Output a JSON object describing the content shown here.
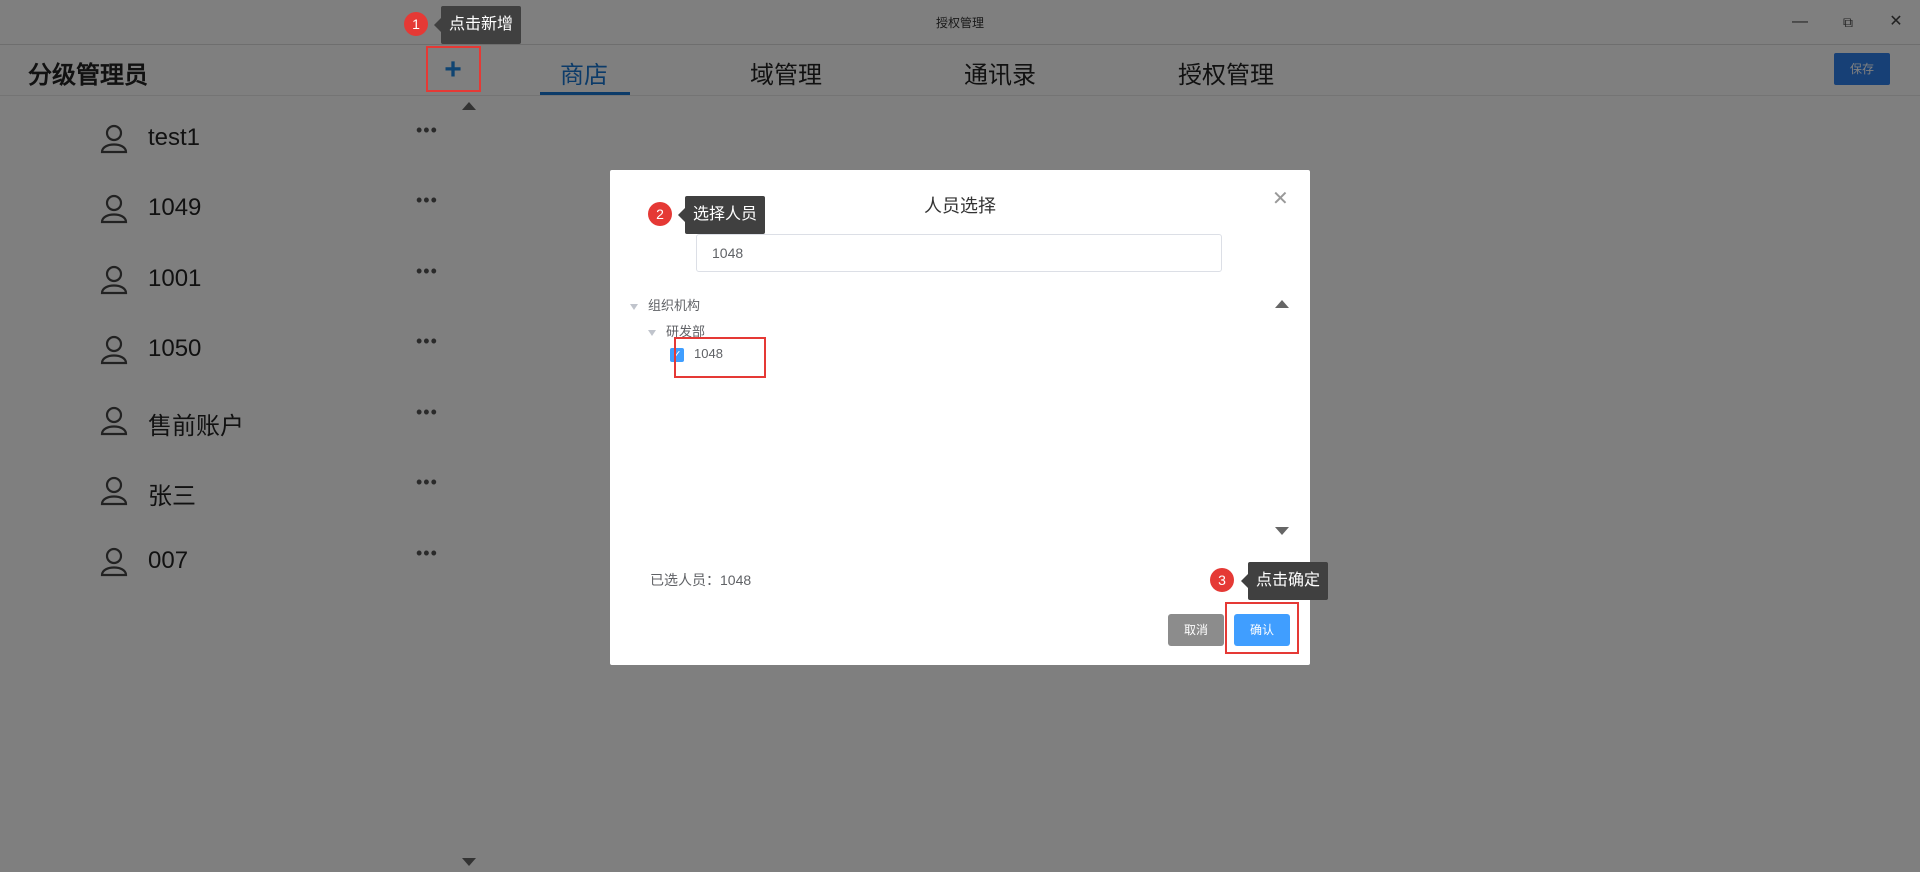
{
  "window": {
    "title": "授权管理",
    "controls": [
      "minimize-icon",
      "restore-icon",
      "close-icon"
    ]
  },
  "app": {
    "title": "分级管理员",
    "add_label": "+",
    "save_label": "保存"
  },
  "tabs": [
    {
      "label": "商店",
      "active": true
    },
    {
      "label": "域管理",
      "active": false
    },
    {
      "label": "通讯录",
      "active": false
    },
    {
      "label": "授权管理",
      "active": false
    }
  ],
  "sidebar": {
    "users": [
      {
        "name": "test1",
        "more": "•••"
      },
      {
        "name": "1049",
        "more": "•••"
      },
      {
        "name": "1001",
        "more": "•••"
      },
      {
        "name": "1050",
        "more": "•••"
      },
      {
        "name": "售前账户",
        "more": "•••"
      },
      {
        "name": "张三",
        "more": "•••"
      },
      {
        "name": "007",
        "more": "•••"
      }
    ]
  },
  "modal": {
    "title": "人员选择",
    "search_value": "1048",
    "tree": {
      "root": "组织机构",
      "dept": "研发部",
      "member": "1048",
      "member_checked": true
    },
    "selected_label": "已选人员：1048",
    "cancel_label": "取消",
    "confirm_label": "确认"
  },
  "annotations": [
    {
      "step": "1",
      "text": "点击新增"
    },
    {
      "step": "2",
      "text": "选择人员"
    },
    {
      "step": "3",
      "text": "点击确定"
    }
  ],
  "colors": {
    "accent": "#1976d2",
    "highlight": "#e53935",
    "confirm": "#409eff",
    "tooltip": "#404040"
  }
}
